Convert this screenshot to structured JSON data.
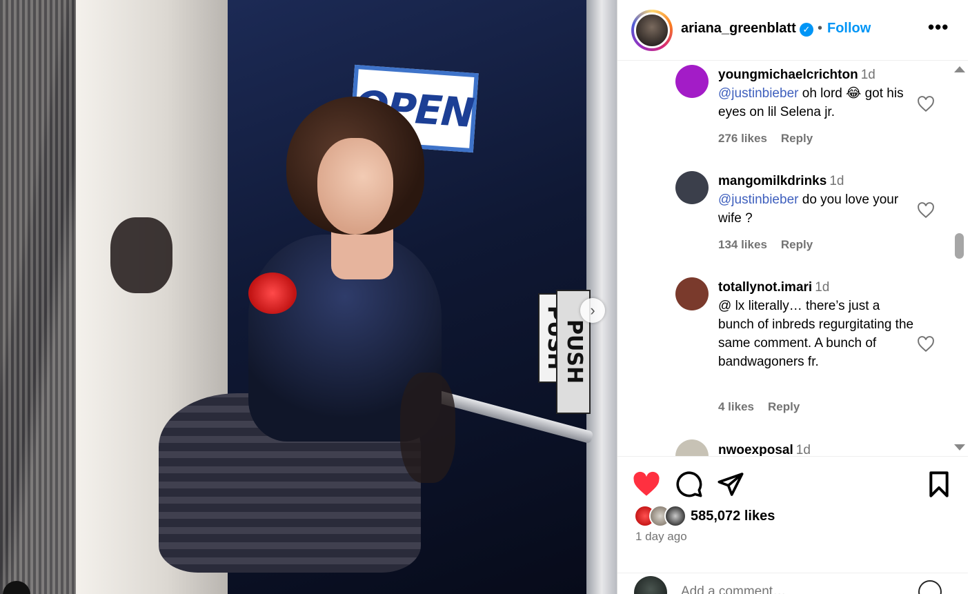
{
  "post": {
    "username": "ariana_greenblatt",
    "verified": true,
    "follow_label": "Follow",
    "separator": "•",
    "more_label": "•••",
    "photo": {
      "sign_text": "OPEN",
      "push_text": "PUSH",
      "next_icon": "chevron-right-icon"
    }
  },
  "comments": [
    {
      "user": "youngmichaelcrichton",
      "time": "1d",
      "mention": "@justinbieber",
      "text": " oh lord 😂 got his eyes on lil Selena jr.",
      "likes": "276 likes",
      "reply": "Reply",
      "avatar_color": "#a31cc7"
    },
    {
      "user": "mangomilkdrinks",
      "time": "1d",
      "mention": "@justinbieber",
      "text": " do you love your wife ?",
      "likes": "134 likes",
      "reply": "Reply",
      "avatar_color": "#3b3f4b"
    },
    {
      "user": "totallynot.imari",
      "time": "1d",
      "mention": "",
      "text": "@ lx literally… there’s just a bunch of inbreds regurgitating the same comment. A bunch of bandwagoners fr.",
      "likes": "4 likes",
      "reply": "Reply",
      "avatar_color": "#7a3a2c"
    },
    {
      "user": "nwoexposal",
      "time": "1d",
      "mention": "",
      "text": "",
      "likes": "",
      "reply": "",
      "avatar_color": "#c7c2b5"
    }
  ],
  "actions": {
    "like_icon": "heart-filled-icon",
    "comment_icon": "comment-icon",
    "share_icon": "send-icon",
    "save_icon": "bookmark-icon",
    "likes_count": "585,072 likes",
    "posted_ago": "1 day ago",
    "comment_placeholder": "Add a comment…",
    "like_color": "#ff3040"
  }
}
